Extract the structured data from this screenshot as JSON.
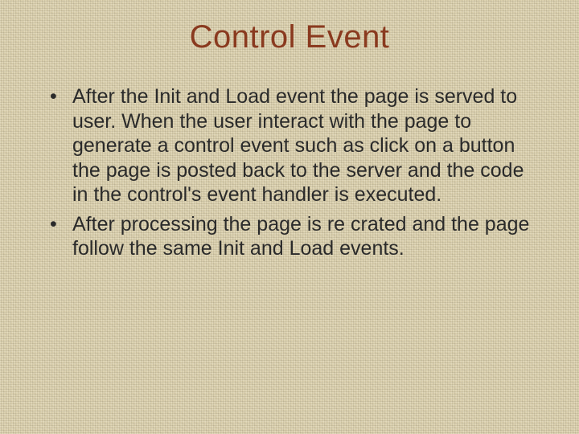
{
  "title": "Control Event",
  "bullets": [
    "After the Init and Load event the page is served to user. When the user interact with the page to generate a control event such as click on a button the page is posted back to the server and the code in the control's event handler is executed.",
    "After processing the page is re crated and the page follow the same Init and Load events."
  ]
}
